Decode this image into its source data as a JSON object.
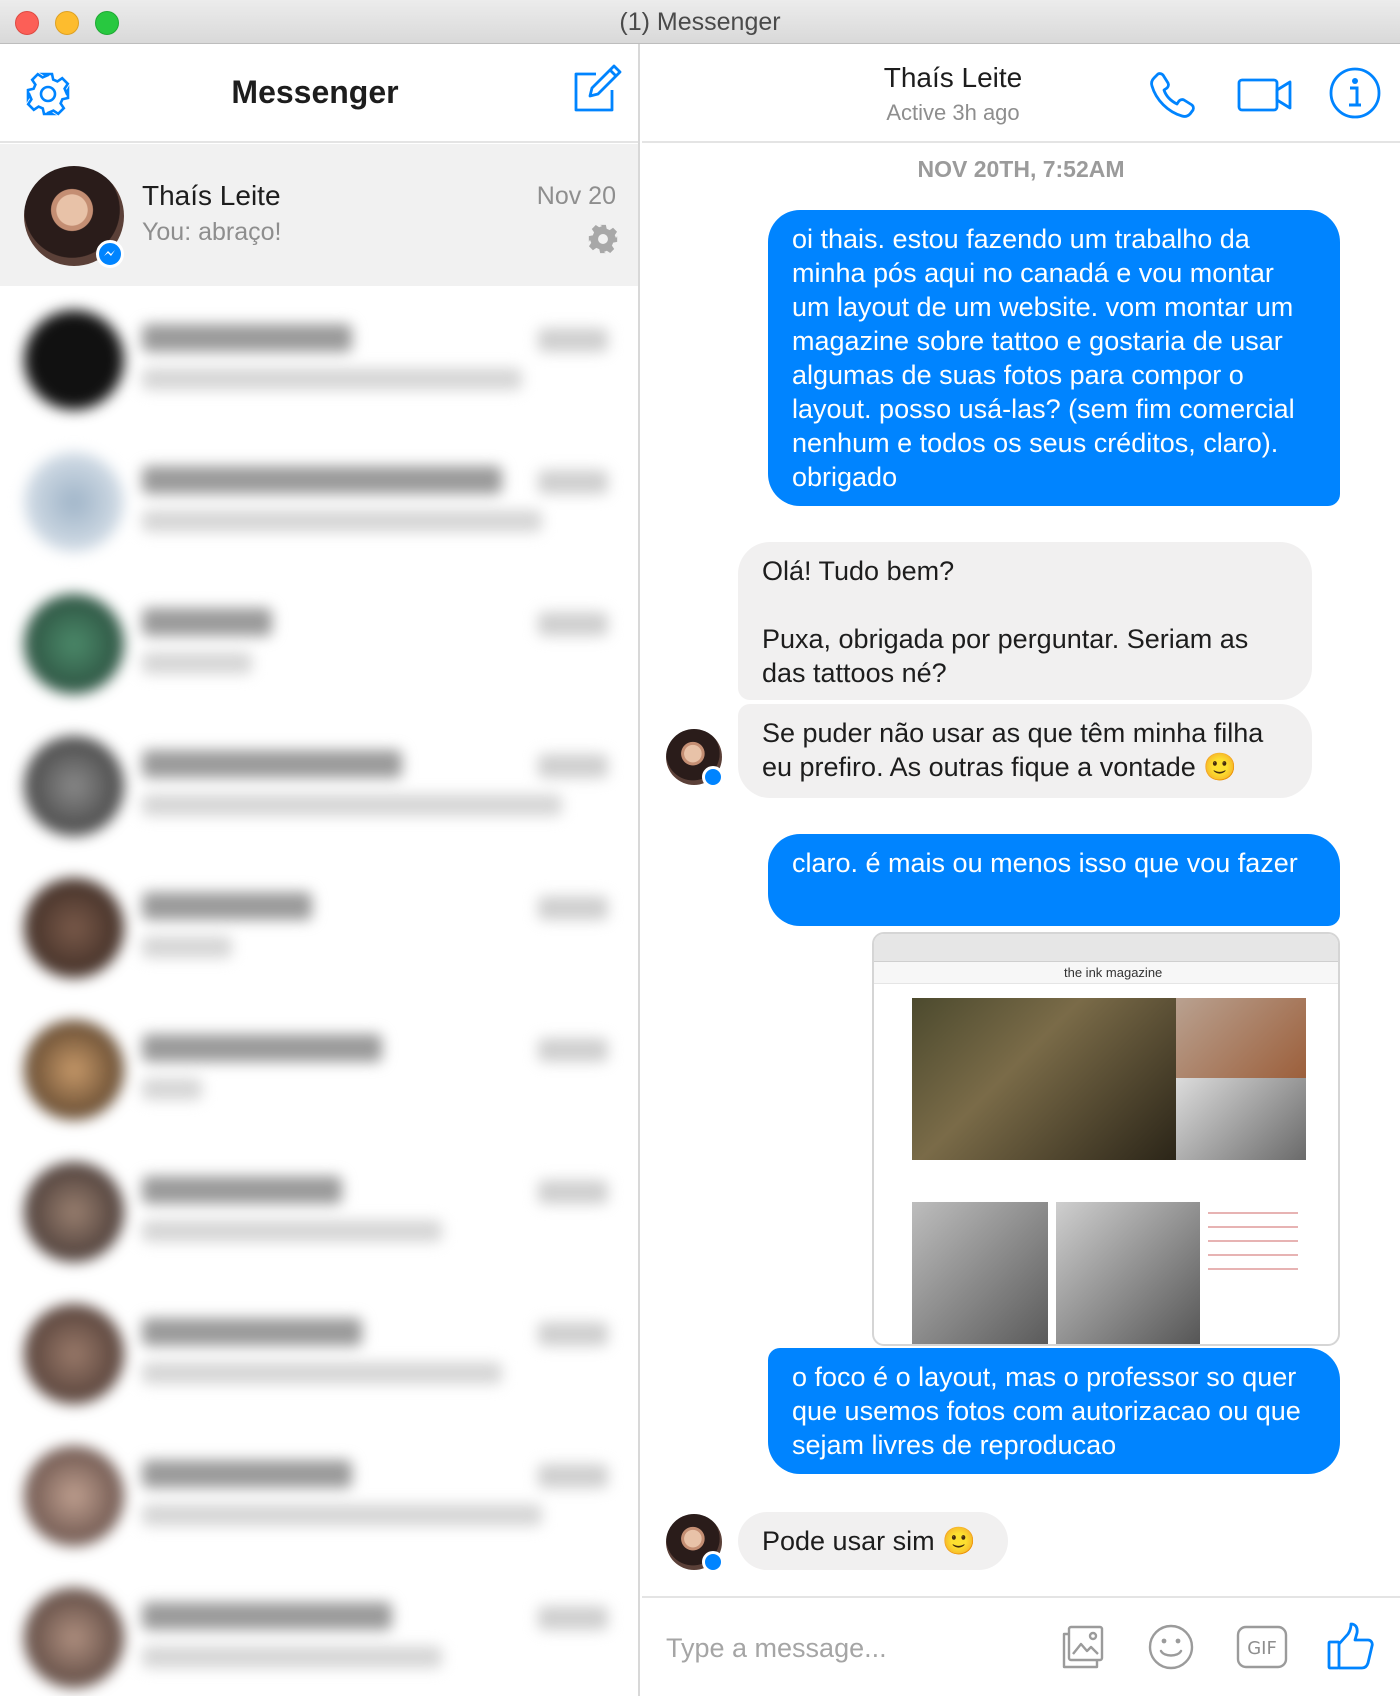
{
  "window": {
    "title": "(1) Messenger"
  },
  "sidebar": {
    "title": "Messenger",
    "settings_icon": "gear-icon",
    "compose_icon": "compose-icon",
    "active_conversation": {
      "name": "Thaís Leite",
      "preview": "You: abraço!",
      "date": "Nov 20",
      "settings_icon": "gear-icon"
    },
    "blurred_rows": 10
  },
  "chat": {
    "contact_name": "Thaís Leite",
    "contact_status": "Active 3h ago",
    "header_icons": [
      "phone-icon",
      "video-camera-icon",
      "info-icon"
    ],
    "date_separator": "NOV 20TH, 7:52AM",
    "messages": [
      {
        "from": "me",
        "text": "oi thais. estou fazendo um trabalho da minha pós aqui no canadá e vou montar um layout de um website. vom montar um magazine sobre tattoo e gostaria de usar algumas de suas fotos para compor o layout. posso usá-las? (sem fim comercial nenhum e todos os seus créditos, claro). obrigado"
      },
      {
        "from": "them",
        "text": "Olá! Tudo bem?\n\nPuxa, obrigada por perguntar. Seriam as das tattoos né?"
      },
      {
        "from": "them",
        "text": "Se puder não usar as que têm minha filha eu prefiro. As outras fique a vontade 🙂"
      },
      {
        "from": "me",
        "text": "claro. é mais ou menos isso que vou fazer"
      },
      {
        "from": "me",
        "type": "image",
        "caption": "the ink magazine"
      },
      {
        "from": "me",
        "text": "o foco é o layout, mas o professor so quer que usemos fotos com autorizacao ou que sejam livres de reproducao"
      },
      {
        "from": "them",
        "text": "Pode usar sim 🙂"
      }
    ],
    "composer": {
      "placeholder": "Type a message...",
      "value": "",
      "gif_label": "GIF",
      "icons": [
        "photo-icon",
        "emoji-icon",
        "gif-icon",
        "thumbs-up-icon"
      ]
    }
  },
  "colors": {
    "accent": "#0084ff",
    "incoming_bubble": "#f1f0f0",
    "muted_text": "#8e8e8e"
  }
}
